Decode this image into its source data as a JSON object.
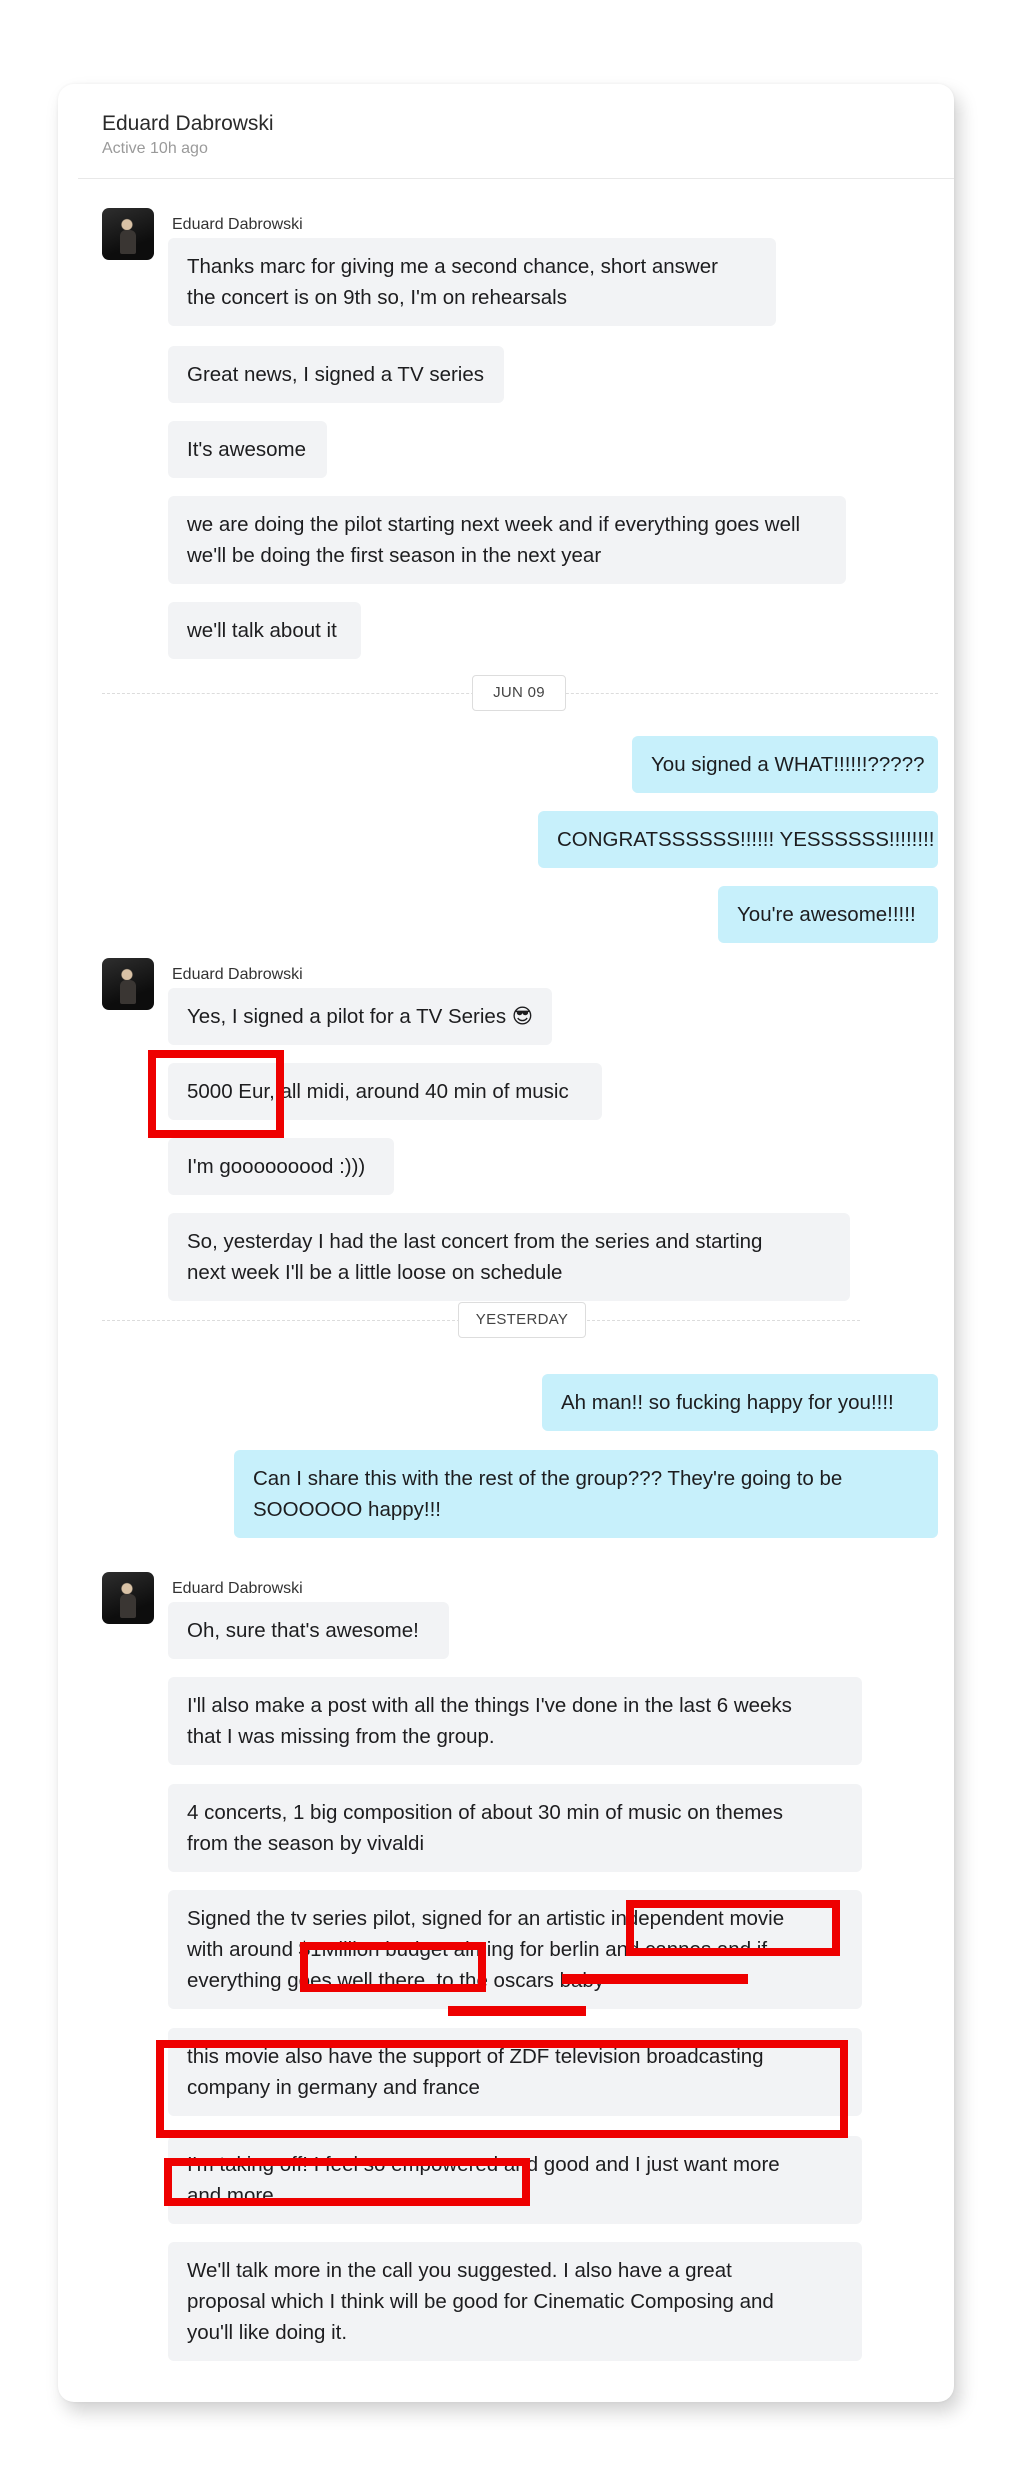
{
  "header": {
    "name": "Eduard Dabrowski",
    "status": "Active 10h ago"
  },
  "dates": [
    "JUN 09",
    "YESTERDAY"
  ],
  "sender_name": "Eduard Dabrowski",
  "group1": [
    "Thanks marc for giving me a second chance, short answer",
    "the concert is on 9th so, I'm on rehearsals",
    "Great news, I signed a TV series",
    "It's awesome",
    "we are doing the pilot starting next week and if everything goes well",
    "we'll be doing the first season in the next year",
    "we'll talk about it"
  ],
  "outgoing1": [
    "You signed a WHAT!!!!!!?????",
    "CONGRATSSSSSS!!!!!! YESSSSSS!!!!!!!!",
    "You're awesome!!!!!"
  ],
  "group2": [
    "Yes, I signed a pilot for a TV Series 😎",
    "5000 Eur, all midi, around 40 min of music",
    "I'm gooooooood :)))",
    "So, yesterday I had the last concert from the series and starting",
    "next week I'll be a little loose on schedule"
  ],
  "outgoing2": [
    "Ah man!! so fucking happy for you!!!!",
    "Can I share this with the rest of the group??? They're going to be",
    "SOOOOOO happy!!!"
  ],
  "group3": [
    "Oh, sure that's awesome!",
    "I'll also make a post with all the things I've done in the last 6 weeks",
    "that I was missing from the group.",
    "4 concerts, 1 big composition of about 30 min of music on themes",
    "from the season by vivaldi",
    "Signed the tv series pilot, signed for an artistic independent movie",
    "with around $1Million budget aiming for berlin and cannes and if",
    "everything goes well there, to the oscars baby",
    "this movie also have the support of ZDF television broadcasting",
    "company in germany and france",
    "I'm taking off! I feel so empowered and good and I just want more",
    "and more.",
    "We'll talk more in the call you suggested. I also have a great",
    "proposal which I think will be good for Cinematic Composing and",
    "you'll like doing it."
  ],
  "colors": {
    "incoming_bubble": "#f2f3f5",
    "outgoing_bubble": "#c7f0fb",
    "annotation_red": "#ee0000"
  }
}
